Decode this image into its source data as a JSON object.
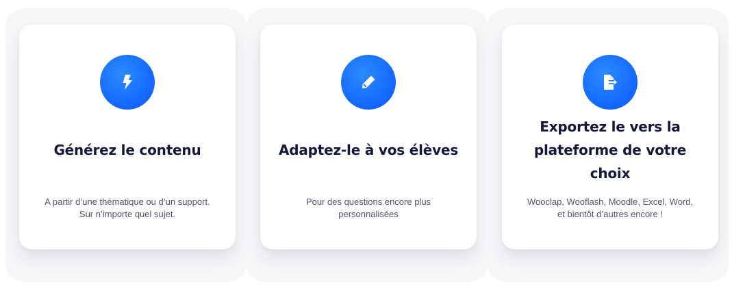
{
  "features": [
    {
      "icon": "lightning-bolt-icon",
      "title": "Générez le contenu",
      "description": "A partir d’une thématique ou d’un support. Sur n’importe quel sujet."
    },
    {
      "icon": "pencil-icon",
      "title": "Adaptez-le à vos élèves",
      "description": "Pour des questions encore plus personnalisées"
    },
    {
      "icon": "file-export-icon",
      "title": "Exportez le vers la plateforme de votre choix",
      "description": "Wooclap, Wooflash, Moodle, Excel, Word, et bientôt d’autres encore !"
    }
  ],
  "colors": {
    "accent": "#1366ff",
    "title": "#14163a",
    "text": "#50546a",
    "background_panel": "#f6f7f9"
  }
}
